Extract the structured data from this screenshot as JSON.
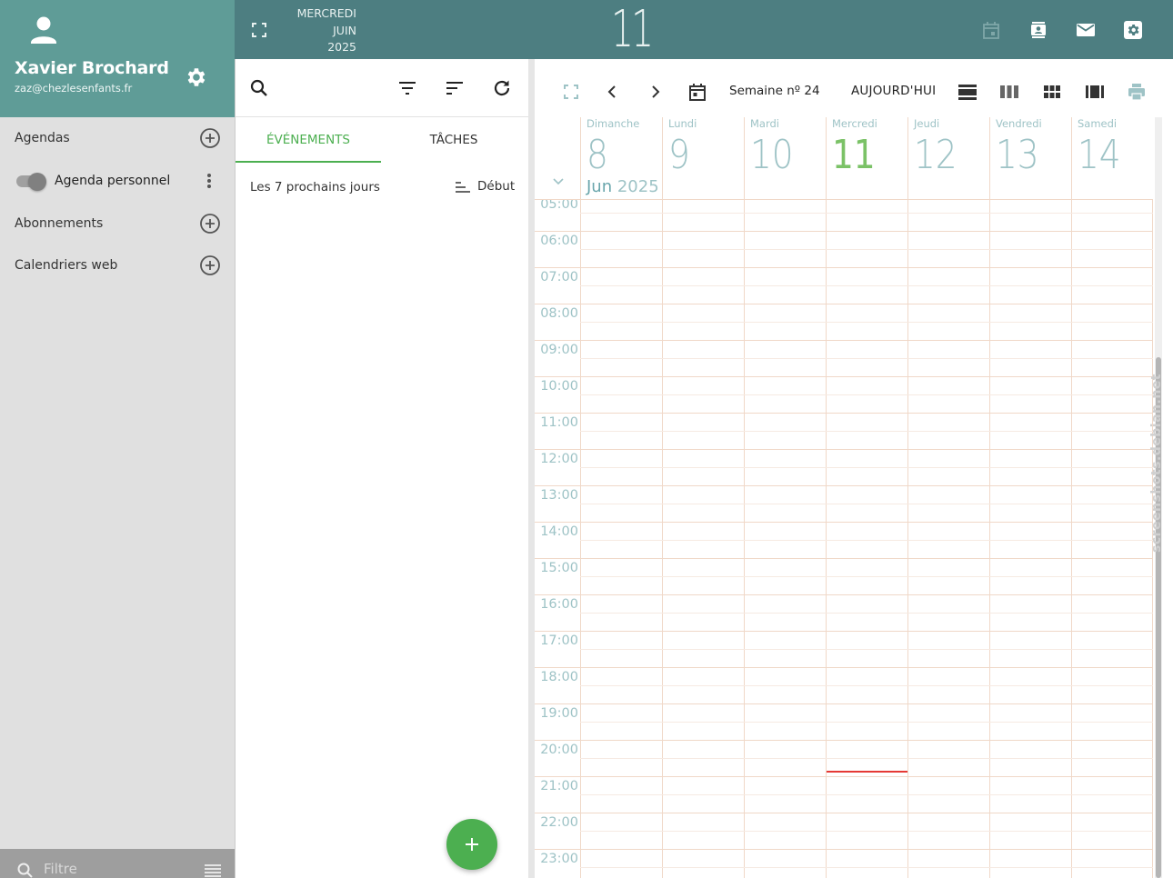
{
  "user": {
    "name": "Xavier Brochard",
    "email": "zaz@chezlesenfants.fr"
  },
  "header": {
    "weekday": "MERCREDI",
    "month": "JUIN",
    "year": "2025",
    "day": "11"
  },
  "sidebar": {
    "agendas_label": "Agendas",
    "personal_agenda_label": "Agenda personnel",
    "subscriptions_label": "Abonnements",
    "web_calendars_label": "Calendriers web",
    "filter_placeholder": "Filtre"
  },
  "list": {
    "tabs": [
      "ÉVÉNEMENTS",
      "TÂCHES"
    ],
    "period_label": "Les 7 prochains jours",
    "sort_label": "Début",
    "fab_icon": "add-icon"
  },
  "calendar": {
    "week_label": "Semaine nº 24",
    "today_label": "AUJOURD'HUI",
    "month_label": "Jun",
    "year_label": "2025",
    "days": [
      {
        "name": "Dimanche",
        "num": "8"
      },
      {
        "name": "Lundi",
        "num": "9"
      },
      {
        "name": "Mardi",
        "num": "10"
      },
      {
        "name": "Mercredi",
        "num": "11"
      },
      {
        "name": "Jeudi",
        "num": "12"
      },
      {
        "name": "Vendredi",
        "num": "13"
      },
      {
        "name": "Samedi",
        "num": "14"
      }
    ],
    "hours": [
      "05:00",
      "06:00",
      "07:00",
      "08:00",
      "09:00",
      "10:00",
      "11:00",
      "12:00",
      "13:00",
      "14:00",
      "15:00",
      "16:00",
      "17:00",
      "18:00",
      "19:00",
      "20:00",
      "21:00",
      "22:00",
      "23:00"
    ]
  },
  "watermark": "screenshots.debian.net",
  "colors": {
    "header": "#4d7e81",
    "user_card": "#5f9c97",
    "sidebar": "#e0e0e0",
    "accent_green": "#4caf50",
    "today_green": "#7bc267",
    "muted_teal": "#9ec3c6",
    "grid_line": "#f0d8c8",
    "now_line": "#e53935"
  }
}
